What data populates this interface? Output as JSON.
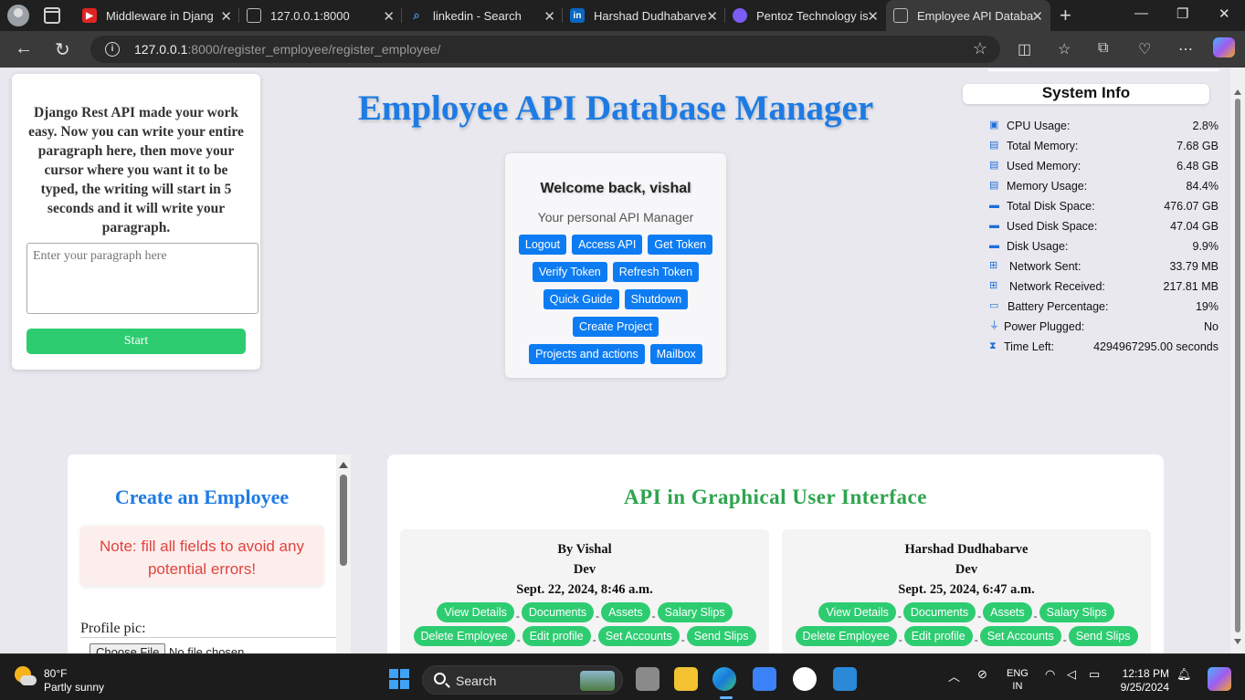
{
  "browser": {
    "tabs": [
      {
        "title": "Middleware in Djang",
        "favicon": "youtube-icon",
        "color": "#e02424"
      },
      {
        "title": "127.0.0.1:8000",
        "favicon": "page-icon",
        "color": "#bbbbbb"
      },
      {
        "title": "linkedin - Search",
        "favicon": "search-icon",
        "color": "#4a8fe8"
      },
      {
        "title": "Harshad Dudhabarve",
        "favicon": "linkedin-icon",
        "color": "#0a66c2"
      },
      {
        "title": "Pentoz Technology is",
        "favicon": "copilot-icon",
        "color": "#7b5cf5"
      },
      {
        "title": "Employee API Databa",
        "favicon": "page-icon",
        "color": "#bbbbbb"
      }
    ],
    "url_host": "127.0.0.1",
    "url_rest": ":8000/register_employee/register_employee/"
  },
  "typer": {
    "description": "Django Rest API made your work easy. Now you can write your entire paragraph here, then move your cursor where you want it to be typed, the writing will start in 5 seconds and it will write your paragraph.",
    "placeholder": "Enter your paragraph here",
    "start_label": "Start"
  },
  "main_title": "Employee API Database Manager",
  "welcome": {
    "greeting": "Welcome back, vishal",
    "subtitle": "Your personal API Manager",
    "rows": [
      [
        "Logout",
        "Access API",
        "Get Token"
      ],
      [
        "Verify Token",
        "Refresh Token"
      ],
      [
        "Quick Guide",
        "Shutdown"
      ],
      [
        "Create Project"
      ],
      [
        "Projects and actions",
        "Mailbox"
      ]
    ]
  },
  "system_info": {
    "title": "System Info",
    "items": [
      {
        "icon": "cpu-icon",
        "label": "CPU Usage:",
        "value": "2.8%"
      },
      {
        "icon": "memory-icon",
        "label": "Total Memory:",
        "value": "7.68 GB"
      },
      {
        "icon": "memory-icon",
        "label": "Used Memory:",
        "value": "6.48 GB"
      },
      {
        "icon": "memory-icon",
        "label": "Memory Usage:",
        "value": "84.4%"
      },
      {
        "icon": "disk-icon",
        "label": "Total Disk Space:",
        "value": "476.07 GB"
      },
      {
        "icon": "disk-icon",
        "label": "Used Disk Space:",
        "value": "47.04 GB"
      },
      {
        "icon": "disk-icon",
        "label": "Disk Usage:",
        "value": "9.9%"
      },
      {
        "icon": "network-icon",
        "label": "Network Sent:",
        "value": "33.79 MB"
      },
      {
        "icon": "network-icon",
        "label": "Network Received:",
        "value": "217.81 MB"
      },
      {
        "icon": "battery-icon",
        "label": "Battery Percentage:",
        "value": "19%"
      },
      {
        "icon": "plug-icon",
        "label": "Power Plugged:",
        "value": "No"
      },
      {
        "icon": "hourglass-icon",
        "label": "Time Left:",
        "value": "4294967295.00 seconds"
      }
    ]
  },
  "create_employee": {
    "title": "Create an Employee",
    "note": "Note: fill all fields to avoid any potential errors!",
    "profile_label": "Profile pic:",
    "file_button": "Choose File",
    "file_status": "No file chosen"
  },
  "gui": {
    "title": "API in Graphical User Interface",
    "cards": [
      {
        "name": "By Vishal",
        "role": "Dev",
        "date": "Sept. 22, 2024, 8:46 a.m.",
        "row1": [
          "View Details",
          "Documents",
          "Assets",
          "Salary Slips"
        ],
        "row2": [
          "Delete Employee",
          "Edit profile",
          "Set Accounts",
          "Send Slips"
        ]
      },
      {
        "name": "Harshad Dudhabarve",
        "role": "Dev",
        "date": "Sept. 25, 2024, 6:47 a.m.",
        "row1": [
          "View Details",
          "Documents",
          "Assets",
          "Salary Slips"
        ],
        "row2": [
          "Delete Employee",
          "Edit profile",
          "Set Accounts",
          "Send Slips"
        ]
      }
    ]
  },
  "taskbar": {
    "temp": "80°F",
    "condition": "Partly sunny",
    "search": "Search",
    "lang_top": "ENG",
    "lang_bottom": "IN",
    "time": "12:18 PM",
    "date": "9/25/2024"
  },
  "colors": {
    "primary_blue": "#1e7be3",
    "button_blue": "#0d7cf2",
    "green": "#2ecc71",
    "note_red": "#e0443c"
  }
}
